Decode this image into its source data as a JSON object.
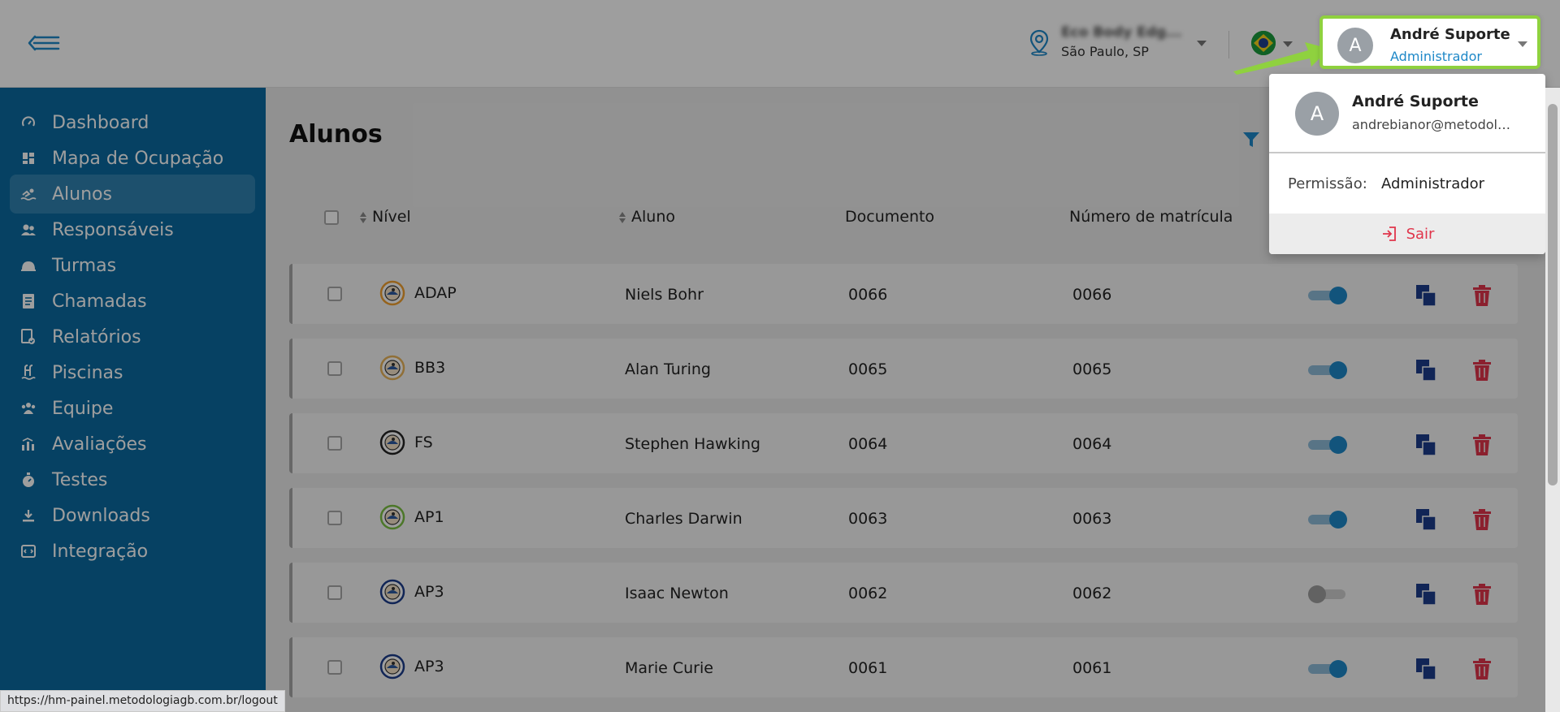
{
  "header": {
    "location_name": "Eco Body Edg...",
    "location_city": "São Paulo, SP",
    "user_name": "André Suporte",
    "user_role": "Administrador",
    "avatar_letter": "A"
  },
  "sidebar": {
    "items": [
      {
        "label": "Dashboard",
        "icon": "dashboard-gauge-icon"
      },
      {
        "label": "Mapa de Ocupação",
        "icon": "grid-map-icon"
      },
      {
        "label": "Alunos",
        "icon": "swimmer-icon",
        "active": true
      },
      {
        "label": "Responsáveis",
        "icon": "people-icon"
      },
      {
        "label": "Turmas",
        "icon": "classes-icon"
      },
      {
        "label": "Chamadas",
        "icon": "attendance-sheet-icon"
      },
      {
        "label": "Relatórios",
        "icon": "report-icon"
      },
      {
        "label": "Piscinas",
        "icon": "pool-ladder-icon"
      },
      {
        "label": "Equipe",
        "icon": "team-icon"
      },
      {
        "label": "Avaliações",
        "icon": "evaluation-icon"
      },
      {
        "label": "Testes",
        "icon": "stopwatch-icon"
      },
      {
        "label": "Downloads",
        "icon": "download-icon"
      },
      {
        "label": "Integração",
        "icon": "integration-icon"
      }
    ]
  },
  "main": {
    "title": "Alunos",
    "columns": {
      "level": "Nível",
      "student": "Aluno",
      "document": "Documento",
      "enrollment": "Número de matrícula"
    },
    "rows": [
      {
        "level": "ADAP",
        "level_color": "#f0a030",
        "name": "Niels Bohr",
        "document": "0066",
        "enrollment": "0066",
        "active": true
      },
      {
        "level": "BB3",
        "level_color": "#e8b45a",
        "name": "Alan Turing",
        "document": "0065",
        "enrollment": "0065",
        "active": true
      },
      {
        "level": "FS",
        "level_color": "#222222",
        "name": "Stephen Hawking",
        "document": "0064",
        "enrollment": "0064",
        "active": true
      },
      {
        "level": "AP1",
        "level_color": "#7bc043",
        "name": "Charles Darwin",
        "document": "0063",
        "enrollment": "0063",
        "active": true
      },
      {
        "level": "AP3",
        "level_color": "#1c3d8c",
        "name": "Isaac Newton",
        "document": "0062",
        "enrollment": "0062",
        "active": false
      },
      {
        "level": "AP3",
        "level_color": "#1c3d8c",
        "name": "Marie Curie",
        "document": "0061",
        "enrollment": "0061",
        "active": true
      }
    ]
  },
  "dropdown": {
    "name": "André Suporte",
    "email": "andrebianor@metodologiagb.com.br",
    "permission_label": "Permissão:",
    "permission_value": "Administrador",
    "logout_label": "Sair"
  },
  "status_bar": {
    "url": "https://hm-painel.metodologiagb.com.br/logout"
  },
  "colors": {
    "sidebar_bg": "#0a6aa1",
    "accent_blue": "#1e88c8",
    "highlight_green": "#8fd13f",
    "delete_red": "#e0354b",
    "copy_navy": "#1c3d8c"
  }
}
